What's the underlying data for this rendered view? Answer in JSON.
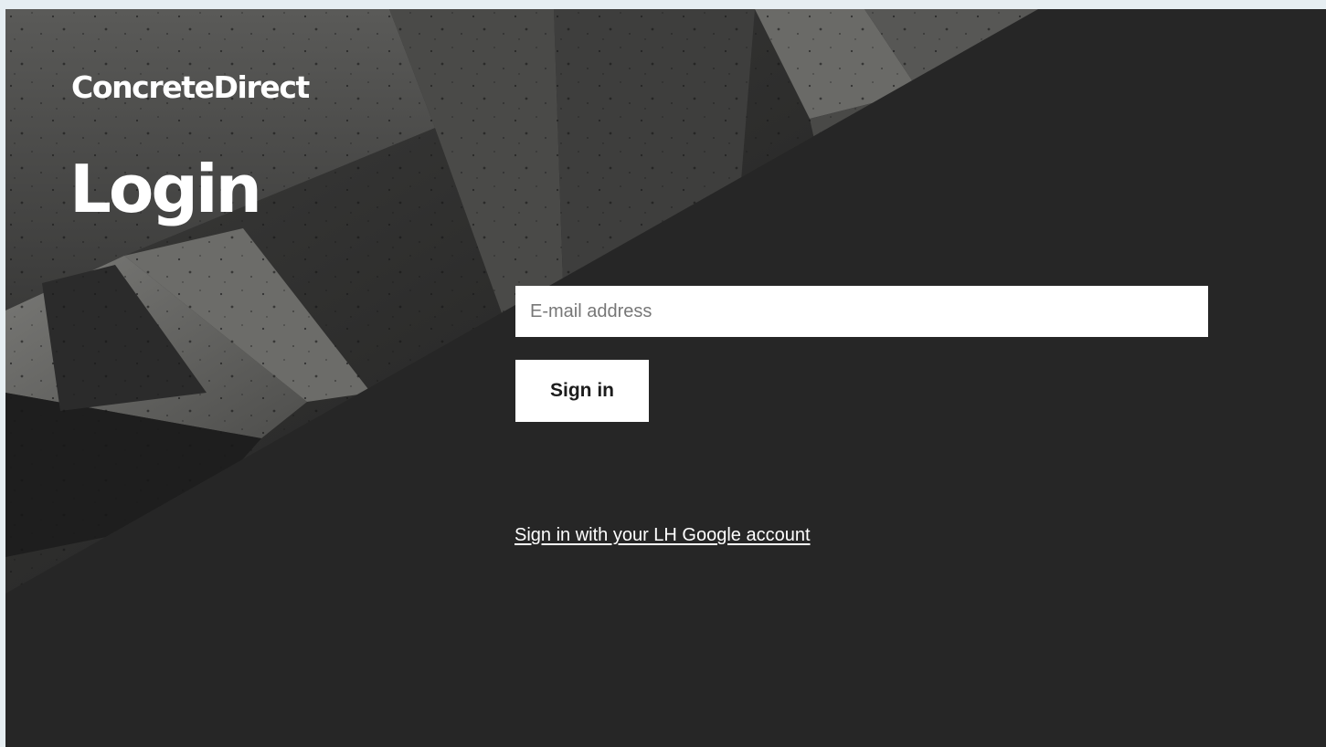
{
  "brand": {
    "name": "ConcreteDirect"
  },
  "page": {
    "title": "Login"
  },
  "form": {
    "email": {
      "placeholder": "E-mail address",
      "value": ""
    },
    "signin_label": "Sign in",
    "google_link": "Sign in with your LH Google account"
  },
  "colors": {
    "page_background": "#e6eef2",
    "panel_background": "#262626",
    "concrete_mid": "#5e5e5c",
    "text": "#ffffff",
    "button_background": "#ffffff",
    "button_text": "#1c1c1c"
  }
}
